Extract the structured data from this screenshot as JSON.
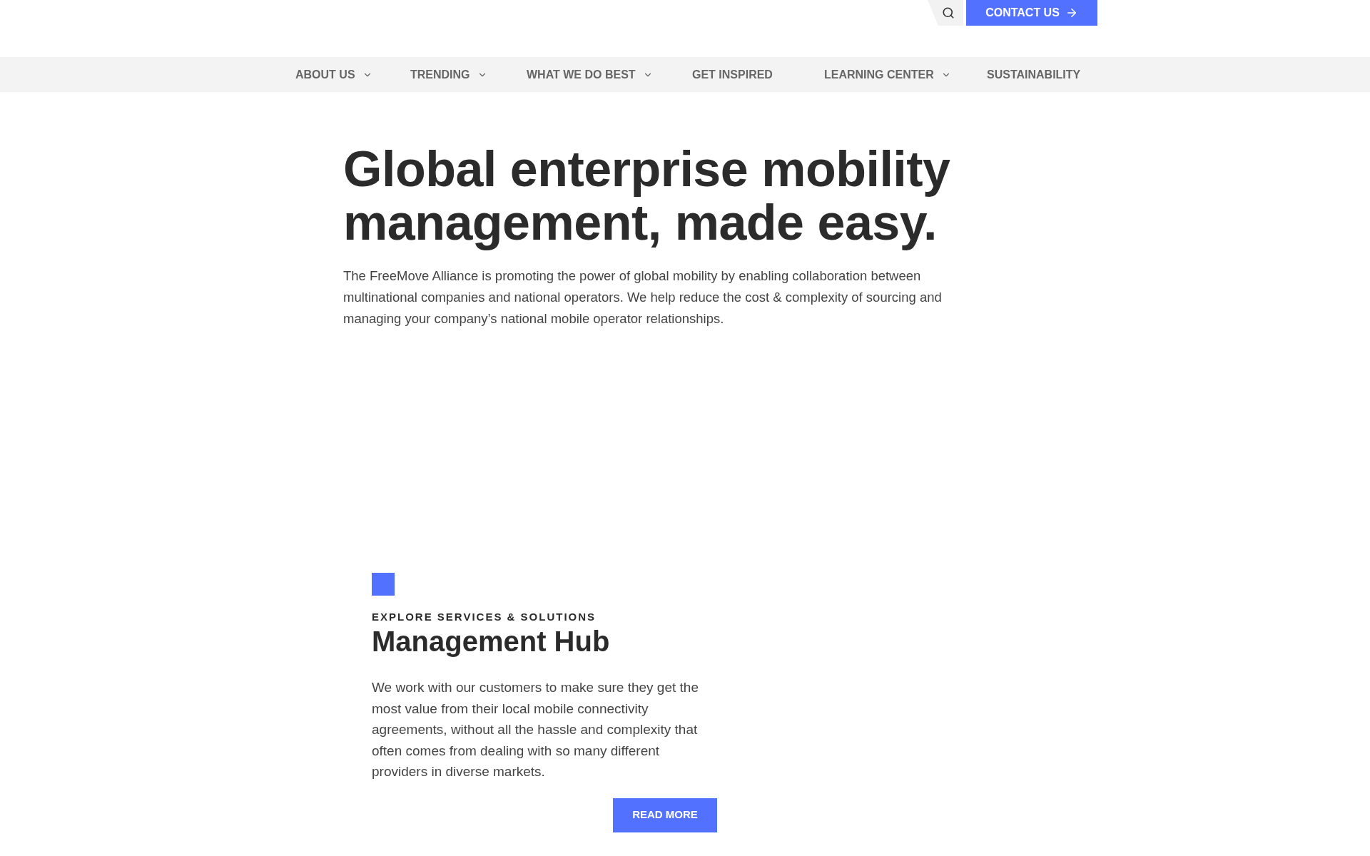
{
  "header": {
    "contact_button": "CONTACT US"
  },
  "nav": {
    "items": [
      {
        "label": "ABOUT US",
        "dropdown": true
      },
      {
        "label": "TRENDING",
        "dropdown": true
      },
      {
        "label": "WHAT WE DO BEST",
        "dropdown": true
      },
      {
        "label": "GET INSPIRED",
        "dropdown": false
      },
      {
        "label": "LEARNING CENTER",
        "dropdown": true
      },
      {
        "label": "SUSTAINABILITY",
        "dropdown": false
      }
    ]
  },
  "hero": {
    "title_lines": [
      "Global enterprise mobility",
      "management, made easy."
    ],
    "text": "The FreeMove Alliance is promoting the power of global mobility by enabling collaboration between multinational companies and national operators. We help reduce the cost & complexity of sourcing and managing your company’s national mobile operator relationships."
  },
  "section": {
    "eyebrow": "EXPLORE SERVICES & SOLUTIONS",
    "title": "Management Hub",
    "text": "We work with our customers to make sure they get the most value from their local mobile connectivity agreements, without all the hassle and complexity that often comes from dealing with so many different providers in diverse markets.",
    "button": "READ MORE"
  }
}
